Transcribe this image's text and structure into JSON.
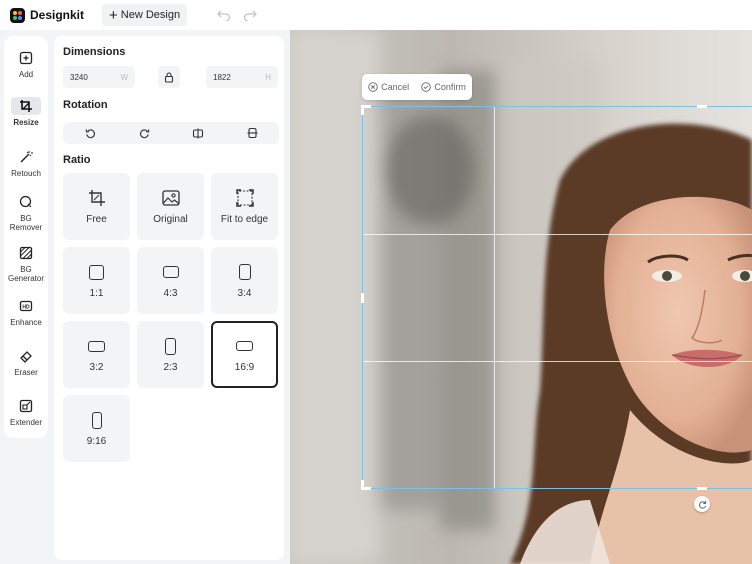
{
  "app": {
    "name": "Designkit",
    "new_design_label": "New Design",
    "logo_colors": [
      "#f5c518",
      "#ff5a5f",
      "#3bc47a",
      "#4c8dff"
    ]
  },
  "rail": {
    "items": [
      {
        "label": "Add",
        "icon": "plus-square-icon"
      },
      {
        "label": "Resize",
        "icon": "crop-icon",
        "active": true
      },
      {
        "label": "Retouch",
        "icon": "magic-wand-icon"
      },
      {
        "label": "BG Remover",
        "icon": "bg-remover-icon"
      },
      {
        "label": "BG Generator",
        "icon": "bg-generator-icon"
      },
      {
        "label": "Enhance",
        "icon": "hd-icon"
      },
      {
        "label": "Eraser",
        "icon": "eraser-icon"
      },
      {
        "label": "Extender",
        "icon": "extender-icon"
      }
    ]
  },
  "panel": {
    "dimensions": {
      "title": "Dimensions",
      "width_value": "3240",
      "width_unit": "W",
      "height_value": "1822",
      "height_unit": "H"
    },
    "rotation": {
      "title": "Rotation",
      "buttons": [
        "rotate-left-icon",
        "rotate-right-icon",
        "flip-horizontal-icon",
        "flip-vertical-icon"
      ]
    },
    "ratio": {
      "title": "Ratio",
      "options": [
        {
          "label": "Free",
          "icon": "free-crop-icon"
        },
        {
          "label": "Original",
          "icon": "image-icon"
        },
        {
          "label": "Fit to edge",
          "icon": "fit-to-edge-icon"
        },
        {
          "label": "1:1"
        },
        {
          "label": "4:3"
        },
        {
          "label": "3:4"
        },
        {
          "label": "3:2"
        },
        {
          "label": "2:3"
        },
        {
          "label": "16:9",
          "selected": true
        },
        {
          "label": "9:16"
        }
      ]
    }
  },
  "canvas": {
    "crop_toolbar": {
      "cancel_label": "Cancel",
      "confirm_label": "Confirm"
    }
  }
}
